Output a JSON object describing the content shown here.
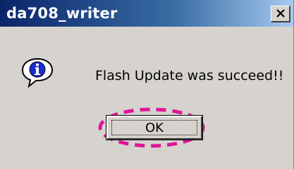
{
  "window": {
    "title": "da708_writer",
    "close_icon": "close-icon"
  },
  "dialog": {
    "icon": "info-icon",
    "message": "Flash Update was succeed!!",
    "ok_label": "OK"
  },
  "colors": {
    "titlebar_start": "#0a246a",
    "titlebar_end": "#a6caf0",
    "dialog_bg": "#d6d3ce",
    "highlight": "#e0149a"
  }
}
